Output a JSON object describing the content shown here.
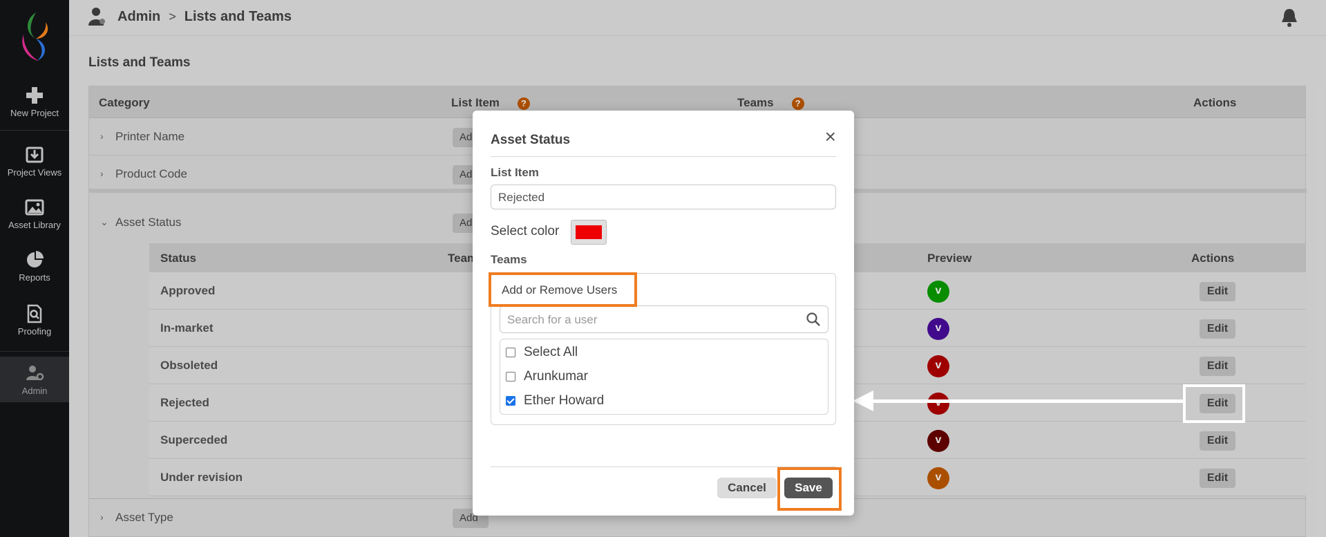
{
  "sidebar": {
    "items": [
      {
        "label": "New Project",
        "icon": "plus-icon"
      },
      {
        "label": "Project Views",
        "icon": "download-tray-icon"
      },
      {
        "label": "Asset Library",
        "icon": "image-icon"
      },
      {
        "label": "Reports",
        "icon": "pie-chart-icon"
      },
      {
        "label": "Proofing",
        "icon": "document-search-icon"
      },
      {
        "label": "Admin",
        "icon": "user-gear-icon"
      }
    ]
  },
  "header": {
    "crumb_root": "Admin",
    "crumb_sep": ">",
    "crumb_current": "Lists and Teams"
  },
  "page": {
    "title": "Lists and Teams",
    "columns": {
      "category": "Category",
      "list_item": "List Item",
      "teams": "Teams",
      "actions": "Actions"
    },
    "help_glyph": "?",
    "add_label": "Add",
    "categories": [
      "Printer Name",
      "Product Code",
      "Asset Status",
      "Asset Type"
    ],
    "sub": {
      "columns": {
        "status": "Status",
        "teams": "Team",
        "preview": "Preview",
        "actions": "Actions"
      },
      "edit_label": "Edit",
      "preview_letter": "v",
      "rows": [
        {
          "status": "Approved",
          "color": "#0aa000"
        },
        {
          "status": "In-market",
          "color": "#4a0ca0"
        },
        {
          "status": "Obsoleted",
          "color": "#b40000"
        },
        {
          "status": "Rejected",
          "color": "#b40000"
        },
        {
          "status": "Superceded",
          "color": "#6a0000"
        },
        {
          "status": "Under revision",
          "color": "#c25a00"
        }
      ]
    }
  },
  "modal": {
    "title": "Asset Status",
    "list_item_label": "List Item",
    "list_item_value": "Rejected",
    "select_color_label": "Select color",
    "selected_color": "#ee0000",
    "teams_label": "Teams",
    "add_remove_label": "Add or Remove Users",
    "search_placeholder": "Search for a user",
    "options": [
      {
        "label": "Select All",
        "checked": false
      },
      {
        "label": "Arunkumar",
        "checked": false
      },
      {
        "label": "Ether Howard",
        "checked": true
      }
    ],
    "cancel_label": "Cancel",
    "save_label": "Save"
  }
}
